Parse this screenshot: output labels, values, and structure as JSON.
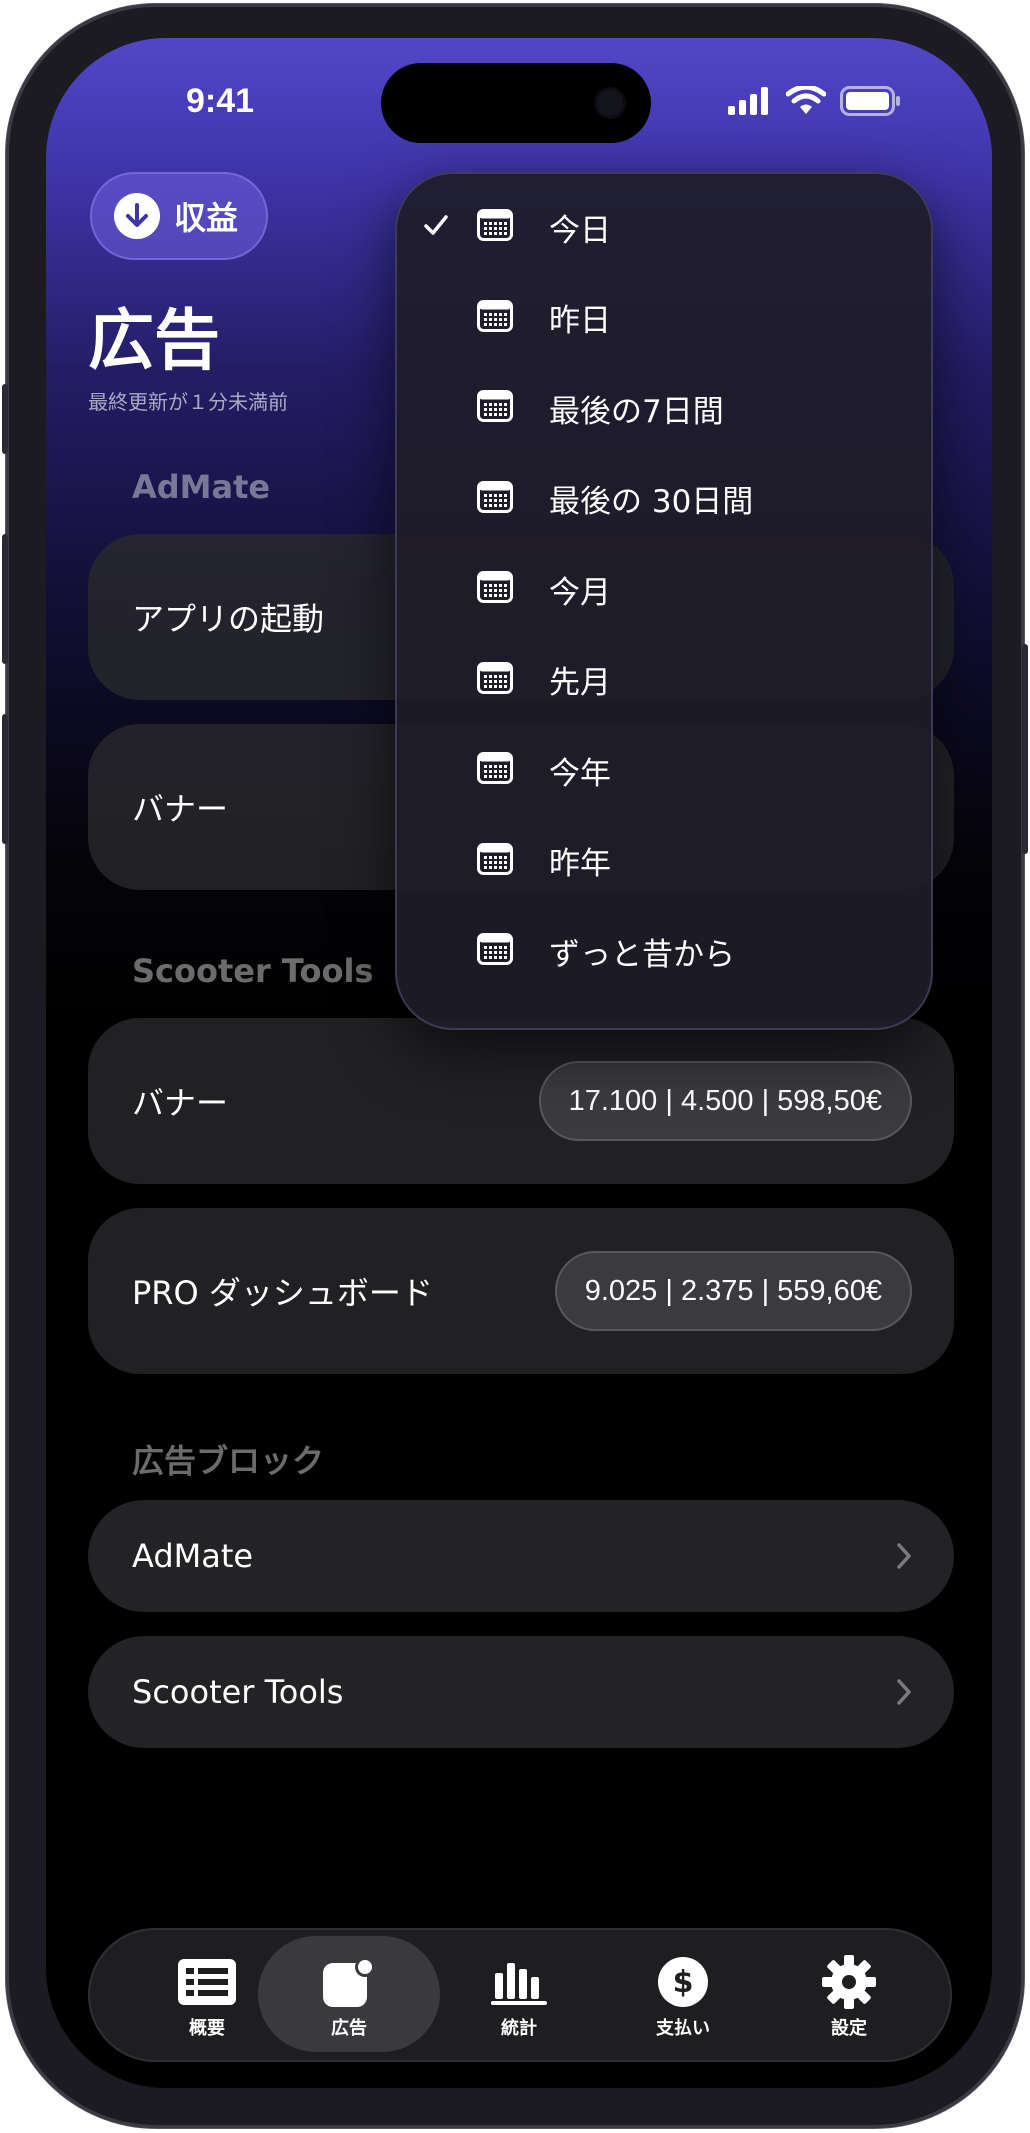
{
  "status_bar": {
    "time": "9:41"
  },
  "header": {
    "earnings_button": "収益",
    "title": "広告",
    "updated": "最終更新が１分未満前"
  },
  "sections": {
    "admate": {
      "title": "AdMate",
      "rows": [
        {
          "name": "アプリの起動"
        },
        {
          "name": "バナー"
        }
      ]
    },
    "scooter": {
      "title": "Scooter Tools",
      "rows": [
        {
          "name": "バナー",
          "value": "17.100 | 4.500 | 598,50€"
        },
        {
          "name": "PRO ダッシュボード",
          "value": "9.025 | 2.375 | 559,60€"
        }
      ]
    },
    "blocks": {
      "title": "広告ブロック",
      "items": [
        {
          "name": "AdMate"
        },
        {
          "name": "Scooter Tools"
        }
      ]
    }
  },
  "date_menu": {
    "selected_index": 0,
    "items": [
      "今日",
      "昨日",
      "最後の7日間",
      "最後の 30日間",
      "今月",
      "先月",
      "今年",
      "昨年",
      "ずっと昔から"
    ]
  },
  "tab_bar": {
    "active": 1,
    "tabs": [
      {
        "label": "概要",
        "icon": "list-icon"
      },
      {
        "label": "広告",
        "icon": "ad-icon"
      },
      {
        "label": "統計",
        "icon": "bar-chart-icon"
      },
      {
        "label": "支払い",
        "icon": "dollar-icon"
      },
      {
        "label": "設定",
        "icon": "gear-icon"
      }
    ]
  }
}
